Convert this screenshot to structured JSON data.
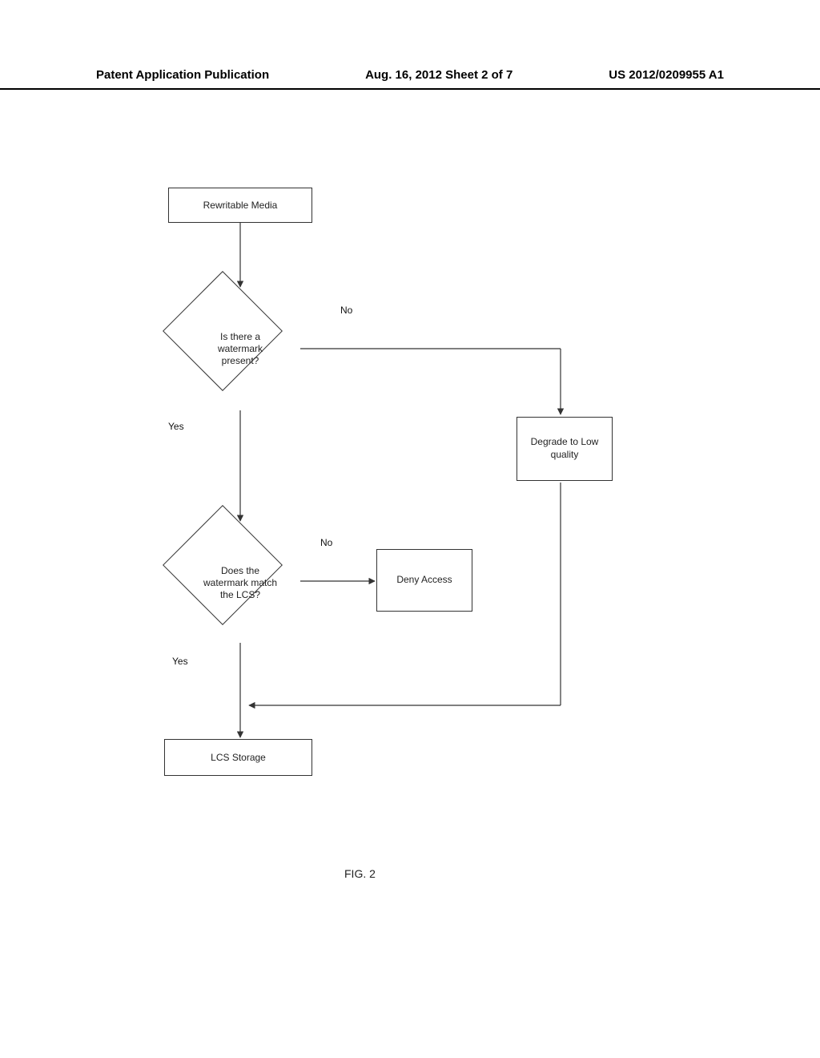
{
  "header": {
    "left": "Patent Application Publication",
    "center": "Aug. 16, 2012  Sheet 2 of 7",
    "right": "US 2012/0209955 A1"
  },
  "nodes": {
    "rewritable": "Rewritable Media",
    "decision1": "Is there a watermark present?",
    "decision2": "Does the watermark match the LCS?",
    "degrade": "Degrade to Low quality",
    "deny": "Deny Access",
    "storage": "LCS Storage"
  },
  "edge_labels": {
    "d1_no": "No",
    "d1_yes": "Yes",
    "d2_no": "No",
    "d2_yes": "Yes"
  },
  "figure_caption": "FIG. 2"
}
